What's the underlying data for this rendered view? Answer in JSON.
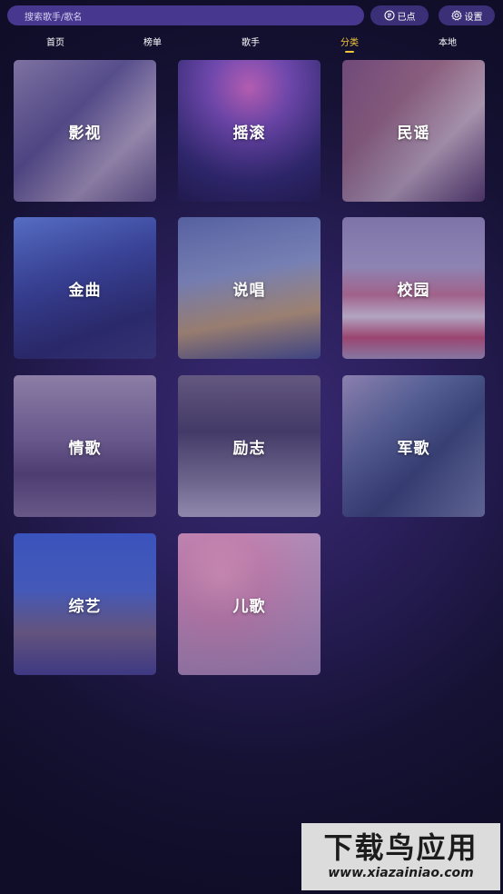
{
  "search": {
    "placeholder": "搜索歌手/歌名"
  },
  "header": {
    "ordered_label": "已点",
    "settings_label": "设置"
  },
  "nav": {
    "tabs": [
      {
        "label": "首页"
      },
      {
        "label": "榜单"
      },
      {
        "label": "歌手"
      },
      {
        "label": "分类"
      },
      {
        "label": "本地"
      }
    ],
    "active": "分类"
  },
  "categories": [
    {
      "label": "影视"
    },
    {
      "label": "摇滚"
    },
    {
      "label": "民谣"
    },
    {
      "label": "金曲"
    },
    {
      "label": "说唱"
    },
    {
      "label": "校园"
    },
    {
      "label": "情歌"
    },
    {
      "label": "励志"
    },
    {
      "label": "军歌"
    },
    {
      "label": "综艺"
    },
    {
      "label": "儿歌"
    }
  ],
  "watermark": {
    "title": "下载鸟应用",
    "url": "www.xiazainiao.com"
  },
  "colors": {
    "accent": "#f4c83a",
    "search_bg": "#48378f",
    "pill_bg": "#3b2f78"
  }
}
